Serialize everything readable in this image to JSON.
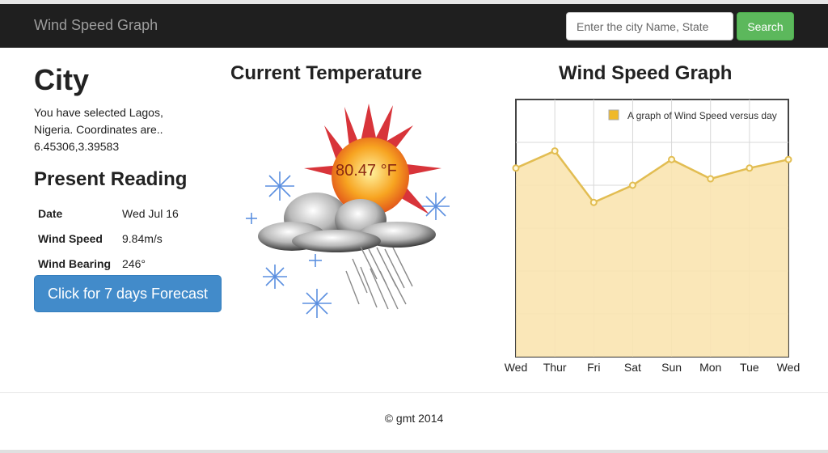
{
  "navbar": {
    "brand": "Wind Speed Graph",
    "search_placeholder": "Enter the city Name, State",
    "search_button": "Search"
  },
  "city": {
    "title": "City",
    "selected_text": "You have selected Lagos, Nigeria. Coordinates are.. 6.45306,3.39583"
  },
  "present_reading": {
    "title": "Present Reading",
    "rows": [
      {
        "key": "Date",
        "value": "Wed Jul 16"
      },
      {
        "key": "Wind Speed",
        "value": "9.84m/s"
      },
      {
        "key": "Wind Bearing",
        "value": "246°"
      }
    ],
    "forecast_button": "Click for 7 days Forecast"
  },
  "current_temperature": {
    "title": "Current Temperature",
    "value": "80.47 °F"
  },
  "wind_graph": {
    "title": "Wind Speed Graph"
  },
  "chart_data": {
    "type": "area",
    "categories": [
      "Wed",
      "Thur",
      "Fri",
      "Sat",
      "Sun",
      "Mon",
      "Tue",
      "Wed"
    ],
    "series": [
      {
        "name": "A graph of Wind Speed versus day",
        "values": [
          7.4,
          7.8,
          6.6,
          7.0,
          7.6,
          7.15,
          7.4,
          7.6
        ]
      }
    ],
    "ylim": [
      3,
      9
    ],
    "grid": true,
    "legend": "top-right",
    "colors": {
      "line": "#e2bd52",
      "fill": "#f9e4b0",
      "legend_swatch": "#f0b929"
    }
  },
  "footer": {
    "text": "© gmt 2014"
  }
}
